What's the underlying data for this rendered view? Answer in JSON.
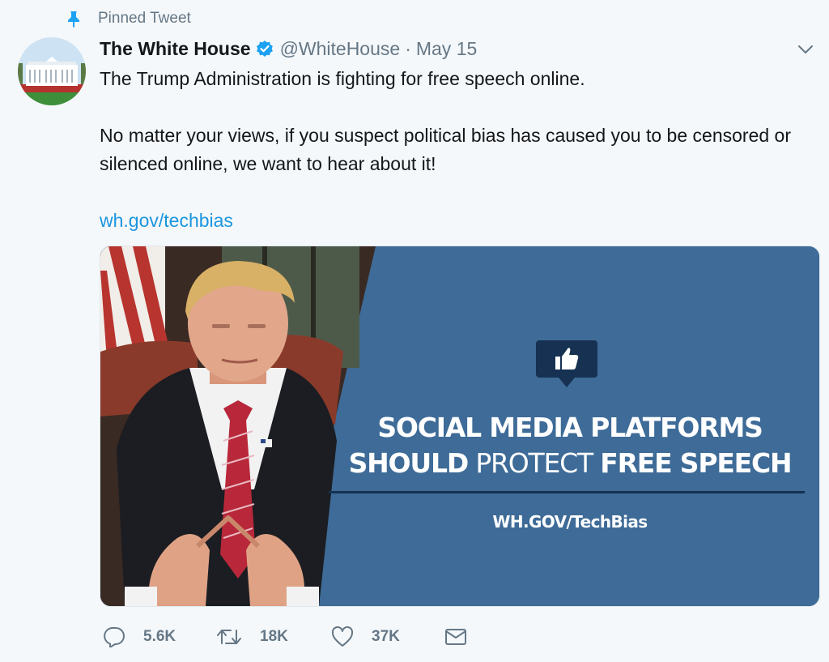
{
  "pinned": {
    "label": "Pinned Tweet",
    "icon": "pin-icon"
  },
  "author": {
    "display_name": "The White House",
    "verified_icon": "verified-badge-icon",
    "handle": "@WhiteHouse",
    "separator": "·",
    "date": "May 15"
  },
  "tweet": {
    "line1": "The Trump Administration is fighting for free speech online.",
    "line2": "No matter your views, if you suspect political bias has caused you to be censored or silenced online, we want to hear about it!",
    "link": "wh.gov/techbias"
  },
  "media": {
    "headline_line1": "SOCIAL MEDIA PLATFORMS",
    "headline_line2_bold_a": "SHOULD",
    "headline_line2_thin": " PROTECT ",
    "headline_line2_bold_b": "FREE SPEECH",
    "site": "WH.GOV/TechBias",
    "badge_icon": "thumbs-up-icon"
  },
  "actions": {
    "reply_count": "5.6K",
    "retweet_count": "18K",
    "like_count": "37K"
  },
  "colors": {
    "background": "#f5f8fa",
    "link": "#1b95e0",
    "muted": "#657786",
    "verified": "#1da1f2",
    "media_blue": "#3e6b97"
  }
}
